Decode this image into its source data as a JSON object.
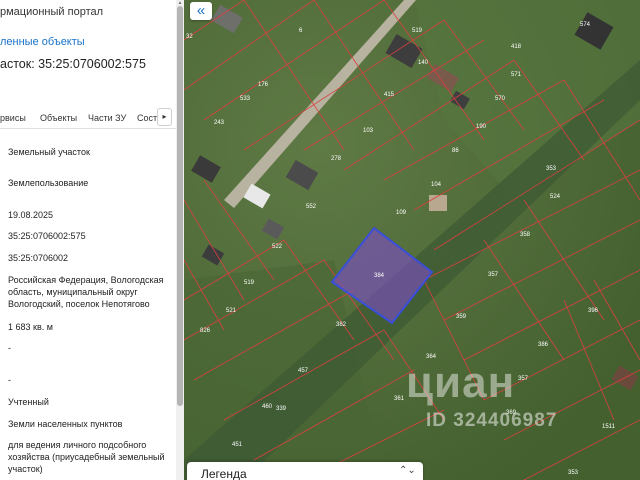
{
  "panel": {
    "title": "рмационный портал",
    "link": "ленные объекты",
    "parcel_heading": "асток: 35:25:0706002:575",
    "tabs": [
      "рвисы",
      "Объекты",
      "Части ЗУ",
      "Соста"
    ],
    "tab_next_icon": "chevron-right-icon",
    "fields": {
      "object_type": "Земельный участок",
      "category_object": "Землепользование",
      "date": "19.08.2025",
      "cadastral_number": "35:25:0706002:575",
      "quarter": "35:25:0706002",
      "address": "Российская Федерация, Вологодская область, муниципальный округ Вологодский, поселок Непотягово",
      "area": "1 683 кв. м",
      "dash1": "-",
      "dash2": "-",
      "status": "Учтенный",
      "land_category": "Земли населенных пунктов",
      "permitted_use": "для ведения личного подсобного хозяйства (приусадебный земельный участок)"
    }
  },
  "map": {
    "collapse_icon": "double-chevron-left-icon",
    "legend_label": "Легенда",
    "legend_toggle_icon": "chevron-up-down-icon",
    "watermark": "циан",
    "watermark_id": "ID 324406987",
    "selected_parcel_color": "#7b4fc0",
    "boundary_color": "#d94040",
    "parcel_numbers": [
      "32",
      "6",
      "519",
      "574",
      "418",
      "176",
      "140",
      "571",
      "533",
      "415",
      "570",
      "243",
      "103",
      "190",
      "86",
      "278",
      "104",
      "353",
      "524",
      "552",
      "109",
      "522",
      "384",
      "358",
      "357",
      "519",
      "521",
      "382",
      "359",
      "396",
      "826",
      "364",
      "386",
      "357",
      "457",
      "361",
      "339",
      "460",
      "369",
      "1511",
      "451",
      "353"
    ]
  }
}
